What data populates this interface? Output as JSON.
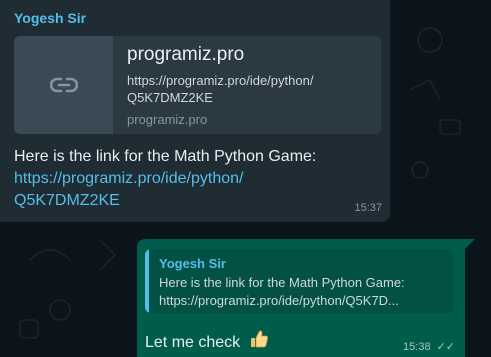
{
  "incoming": {
    "sender": "Yogesh Sir",
    "link_preview": {
      "title": "programiz.pro",
      "description": "https://programiz.pro/ide/python/\nQ5K7DMZ2KE",
      "domain": "programiz.pro",
      "icon": "link-icon"
    },
    "text": "Here is the link for the Math Python Game:",
    "link": "https://programiz.pro/ide/python/\nQ5K7DMZ2KE",
    "time": "15:37"
  },
  "outgoing": {
    "quote": {
      "name": "Yogesh Sir",
      "line1": "Here is the link for the Math Python Game:",
      "line2": "https://programiz.pro/ide/python/Q5K7D..."
    },
    "text": "Let me check",
    "emoji": "thumbs-up-icon",
    "time": "15:38",
    "status_icon": "double-check-icon"
  },
  "colors": {
    "background": "#0b141a",
    "incoming_bubble": "#202c33",
    "outgoing_bubble": "#005c4b",
    "accent": "#53bdeb"
  }
}
